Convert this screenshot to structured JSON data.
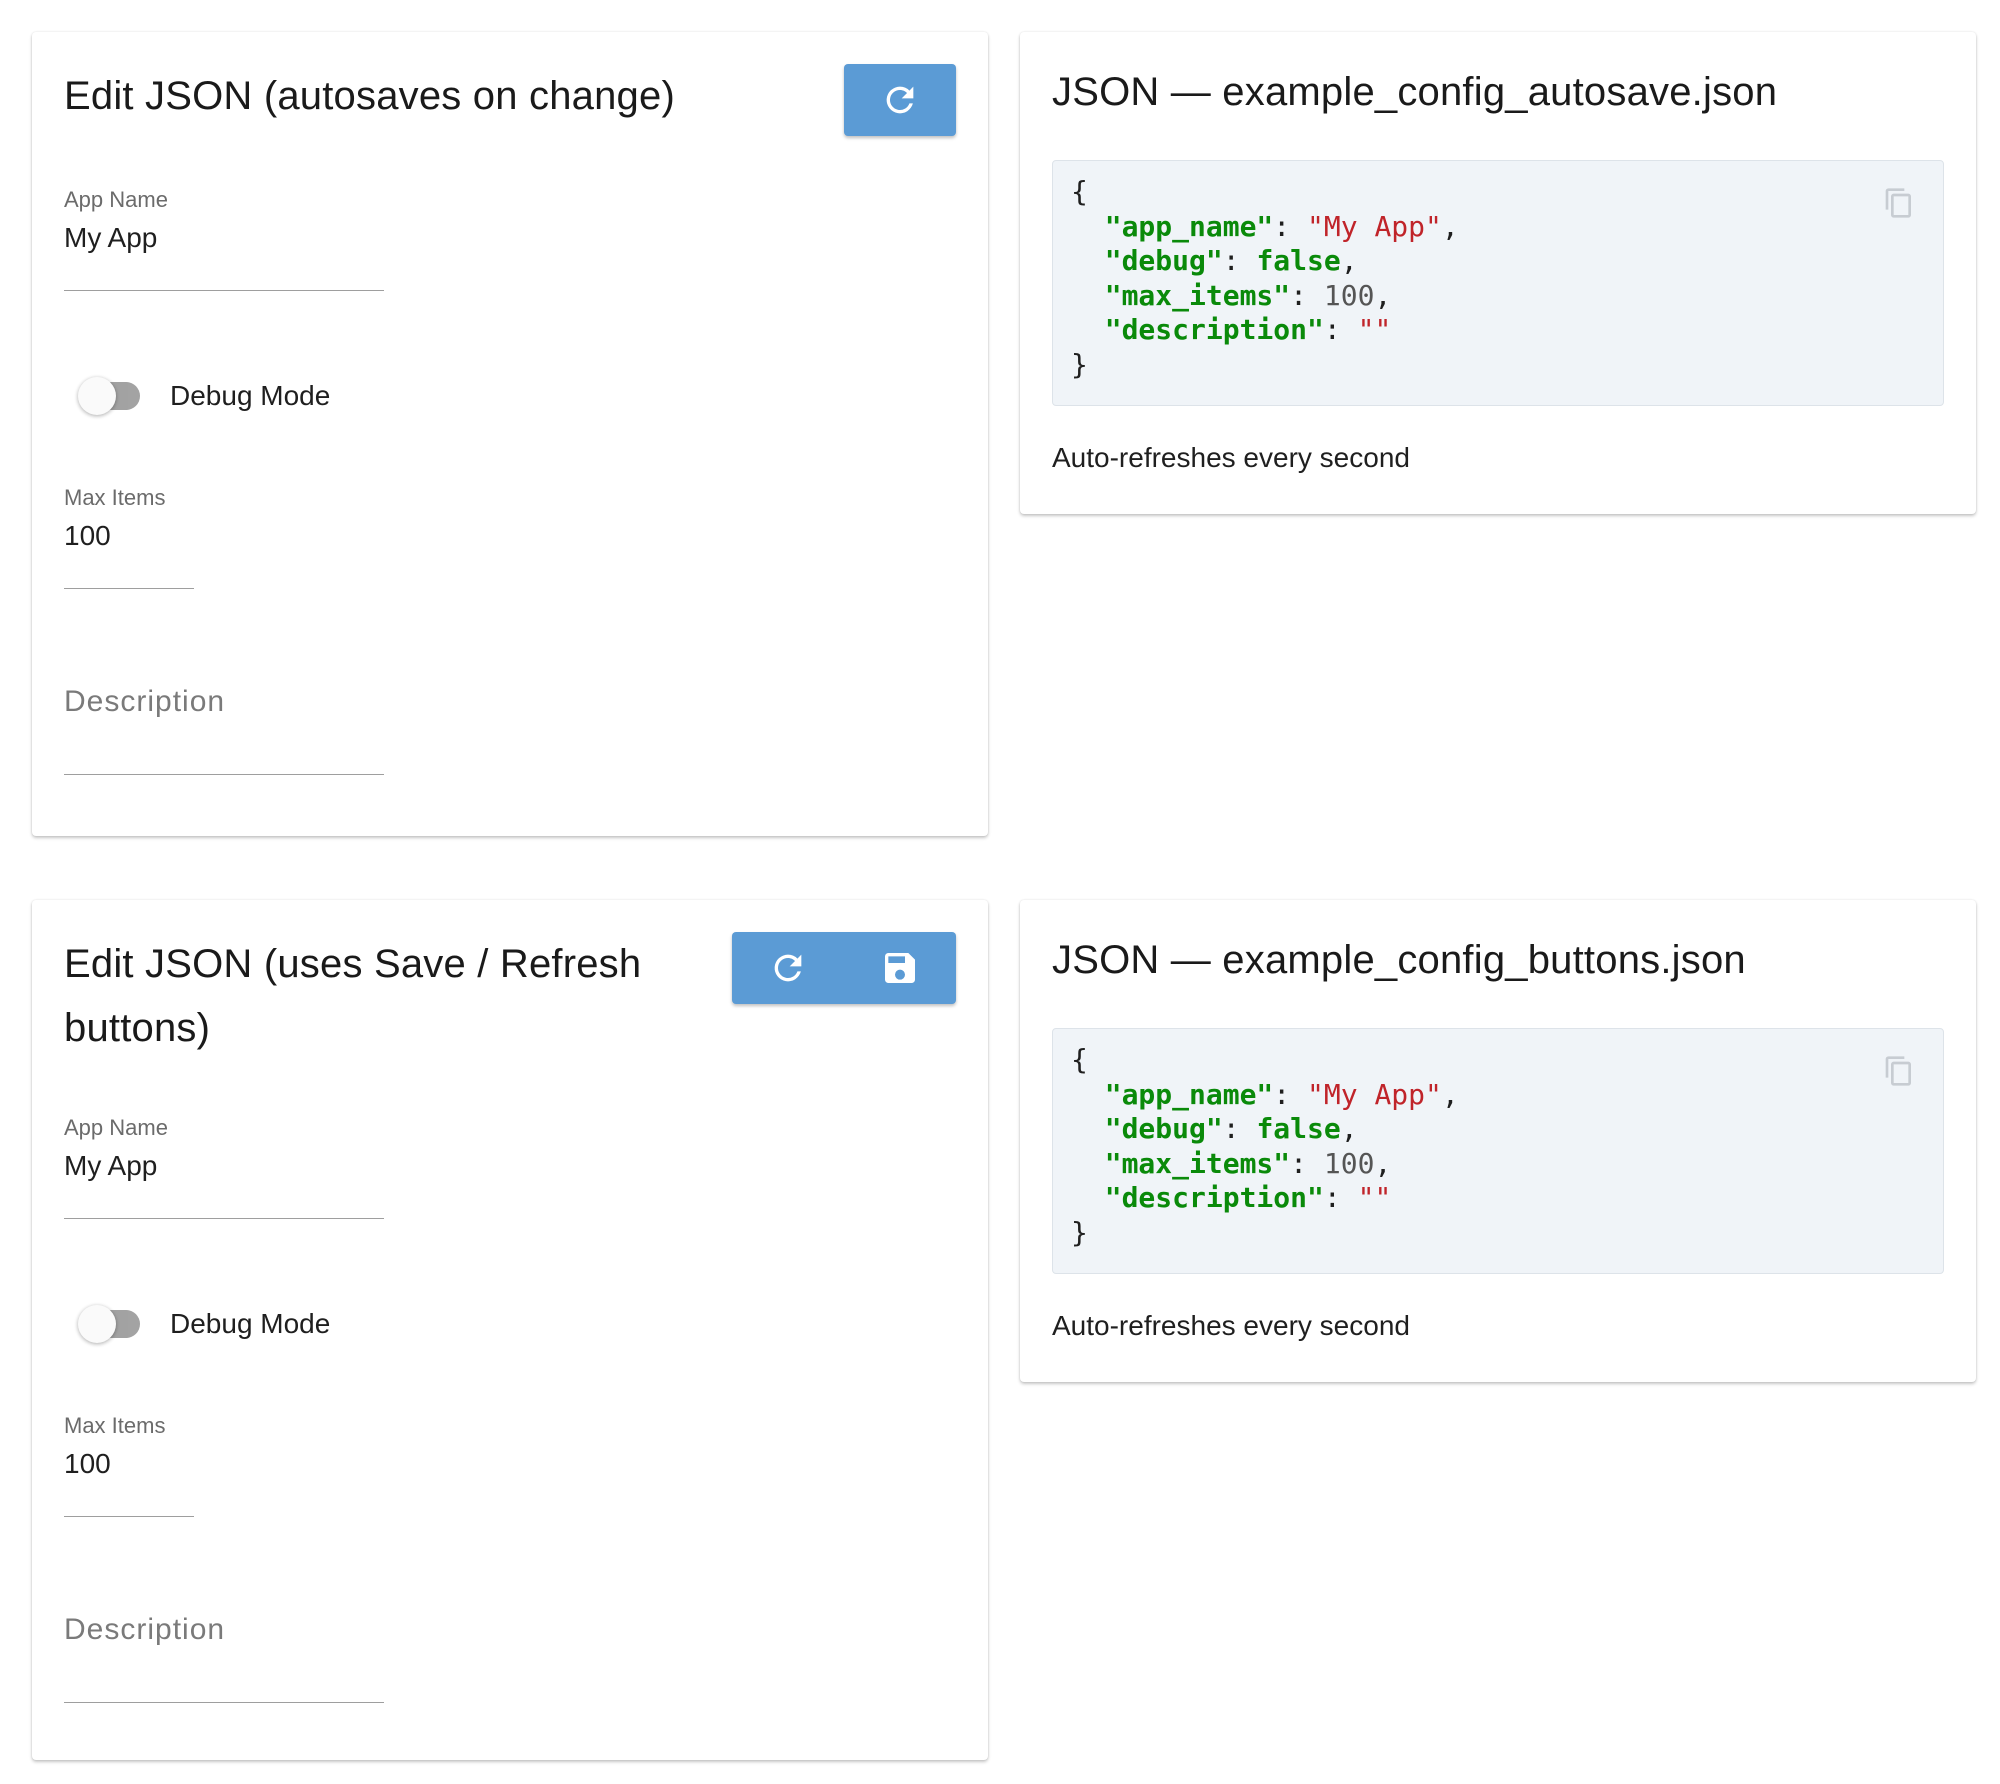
{
  "editor_autosave": {
    "title": "Edit JSON (autosaves on change)",
    "buttons": [
      {
        "icon": "refresh-icon"
      }
    ],
    "fields": {
      "app_name": {
        "label": "App Name",
        "value": "My App"
      },
      "debug": {
        "label": "Debug Mode",
        "checked": false
      },
      "max_items": {
        "label": "Max Items",
        "value": "100"
      },
      "description": {
        "placeholder": "Description",
        "value": ""
      }
    }
  },
  "viewer_autosave": {
    "title": "JSON — example_config_autosave.json",
    "json": {
      "open": "{",
      "close": "}",
      "lines": [
        {
          "key": "\"app_name\"",
          "value": "\"My App\"",
          "type": "string",
          "comma": ","
        },
        {
          "key": "\"debug\"",
          "value": "false",
          "type": "bool",
          "comma": ","
        },
        {
          "key": "\"max_items\"",
          "value": "100",
          "type": "number",
          "comma": ","
        },
        {
          "key": "\"description\"",
          "value": "\"\"",
          "type": "string",
          "comma": ""
        }
      ]
    },
    "copy_icon": "copy-icon",
    "note": "Auto-refreshes every second"
  },
  "editor_buttons": {
    "title": "Edit JSON (uses Save / Refresh buttons)",
    "title_line1": "Edit JSON (uses Save / Refresh",
    "title_line2": "buttons)",
    "buttons": [
      {
        "icon": "refresh-icon"
      },
      {
        "icon": "save-icon"
      }
    ],
    "fields": {
      "app_name": {
        "label": "App Name",
        "value": "My App"
      },
      "debug": {
        "label": "Debug Mode",
        "checked": false
      },
      "max_items": {
        "label": "Max Items",
        "value": "100"
      },
      "description": {
        "placeholder": "Description",
        "value": ""
      }
    }
  },
  "viewer_buttons": {
    "title": "JSON — example_config_buttons.json",
    "json": {
      "open": "{",
      "close": "}",
      "lines": [
        {
          "key": "\"app_name\"",
          "value": "\"My App\"",
          "type": "string",
          "comma": ","
        },
        {
          "key": "\"debug\"",
          "value": "false",
          "type": "bool",
          "comma": ","
        },
        {
          "key": "\"max_items\"",
          "value": "100",
          "type": "number",
          "comma": ","
        },
        {
          "key": "\"description\"",
          "value": "\"\"",
          "type": "string",
          "comma": ""
        }
      ]
    },
    "copy_icon": "copy-icon",
    "note": "Auto-refreshes every second"
  },
  "colors": {
    "button_bg": "#5b9bd5",
    "code_bg": "#f0f4f8",
    "json_key": "#0a8a0a",
    "json_string": "#c0242a",
    "json_number": "#555555"
  }
}
